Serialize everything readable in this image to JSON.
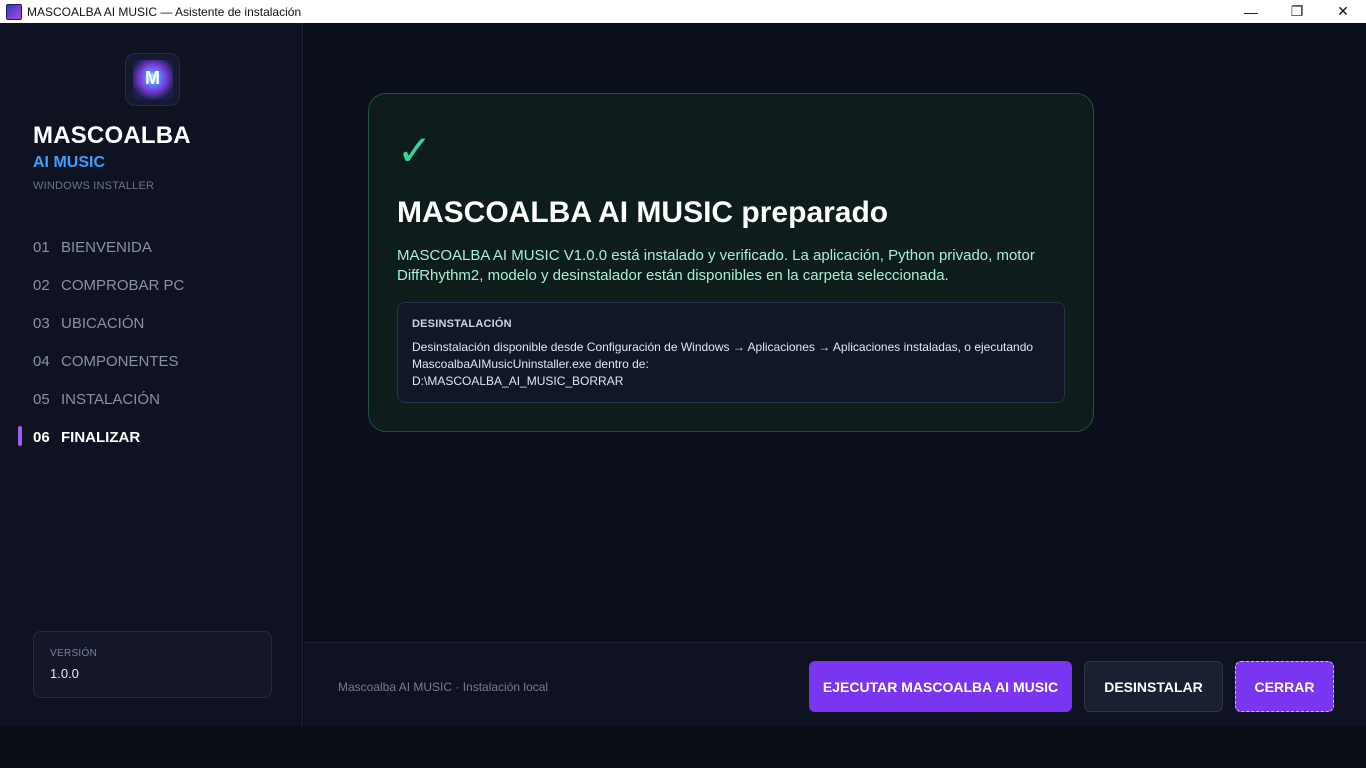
{
  "window": {
    "title": "MASCOALBA AI MUSIC — Asistente de instalación",
    "minimize_glyph": "—",
    "restore_glyph": "❐",
    "close_glyph": "✕"
  },
  "sidebar": {
    "brand_name": "MASCOALBA",
    "brand_sub": "AI MUSIC",
    "brand_tag": "WINDOWS INSTALLER",
    "steps": [
      {
        "num": "01",
        "label": "BIENVENIDA"
      },
      {
        "num": "02",
        "label": "COMPROBAR PC"
      },
      {
        "num": "03",
        "label": "UBICACIÓN"
      },
      {
        "num": "04",
        "label": "COMPONENTES"
      },
      {
        "num": "05",
        "label": "INSTALACIÓN"
      },
      {
        "num": "06",
        "label": "FINALIZAR"
      }
    ],
    "active_step": 5,
    "version_label": "VERSIÓN",
    "version_value": "1.0.0"
  },
  "card": {
    "check_glyph": "✓",
    "title": "MASCOALBA AI MUSIC preparado",
    "description": "MASCOALBA AI MUSIC V1.0.0 está instalado y verificado. La aplicación, Python privado, motor DiffRhythm2, modelo y desinstalador están disponibles en la carpeta seleccionada.",
    "uninstall_title": "DESINSTALACIÓN",
    "uninstall_line1": "Desinstalación disponible desde Configuración de Windows → Aplicaciones → Aplicaciones instaladas, o ejecutando",
    "uninstall_line2": "MascoalbaAIMusicUninstaller.exe dentro de:",
    "uninstall_path": "D:\\MASCOALBA_AI_MUSIC_BORRAR"
  },
  "footer": {
    "text": "Mascoalba AI MUSIC · Instalación local",
    "run_label": "EJECUTAR MASCOALBA AI MUSIC",
    "uninstall_label": "DESINSTALAR",
    "close_label": "CERRAR"
  },
  "colors": {
    "accent": "#7a35f0",
    "success": "#33d691",
    "brand_blue": "#3aa0ff"
  }
}
